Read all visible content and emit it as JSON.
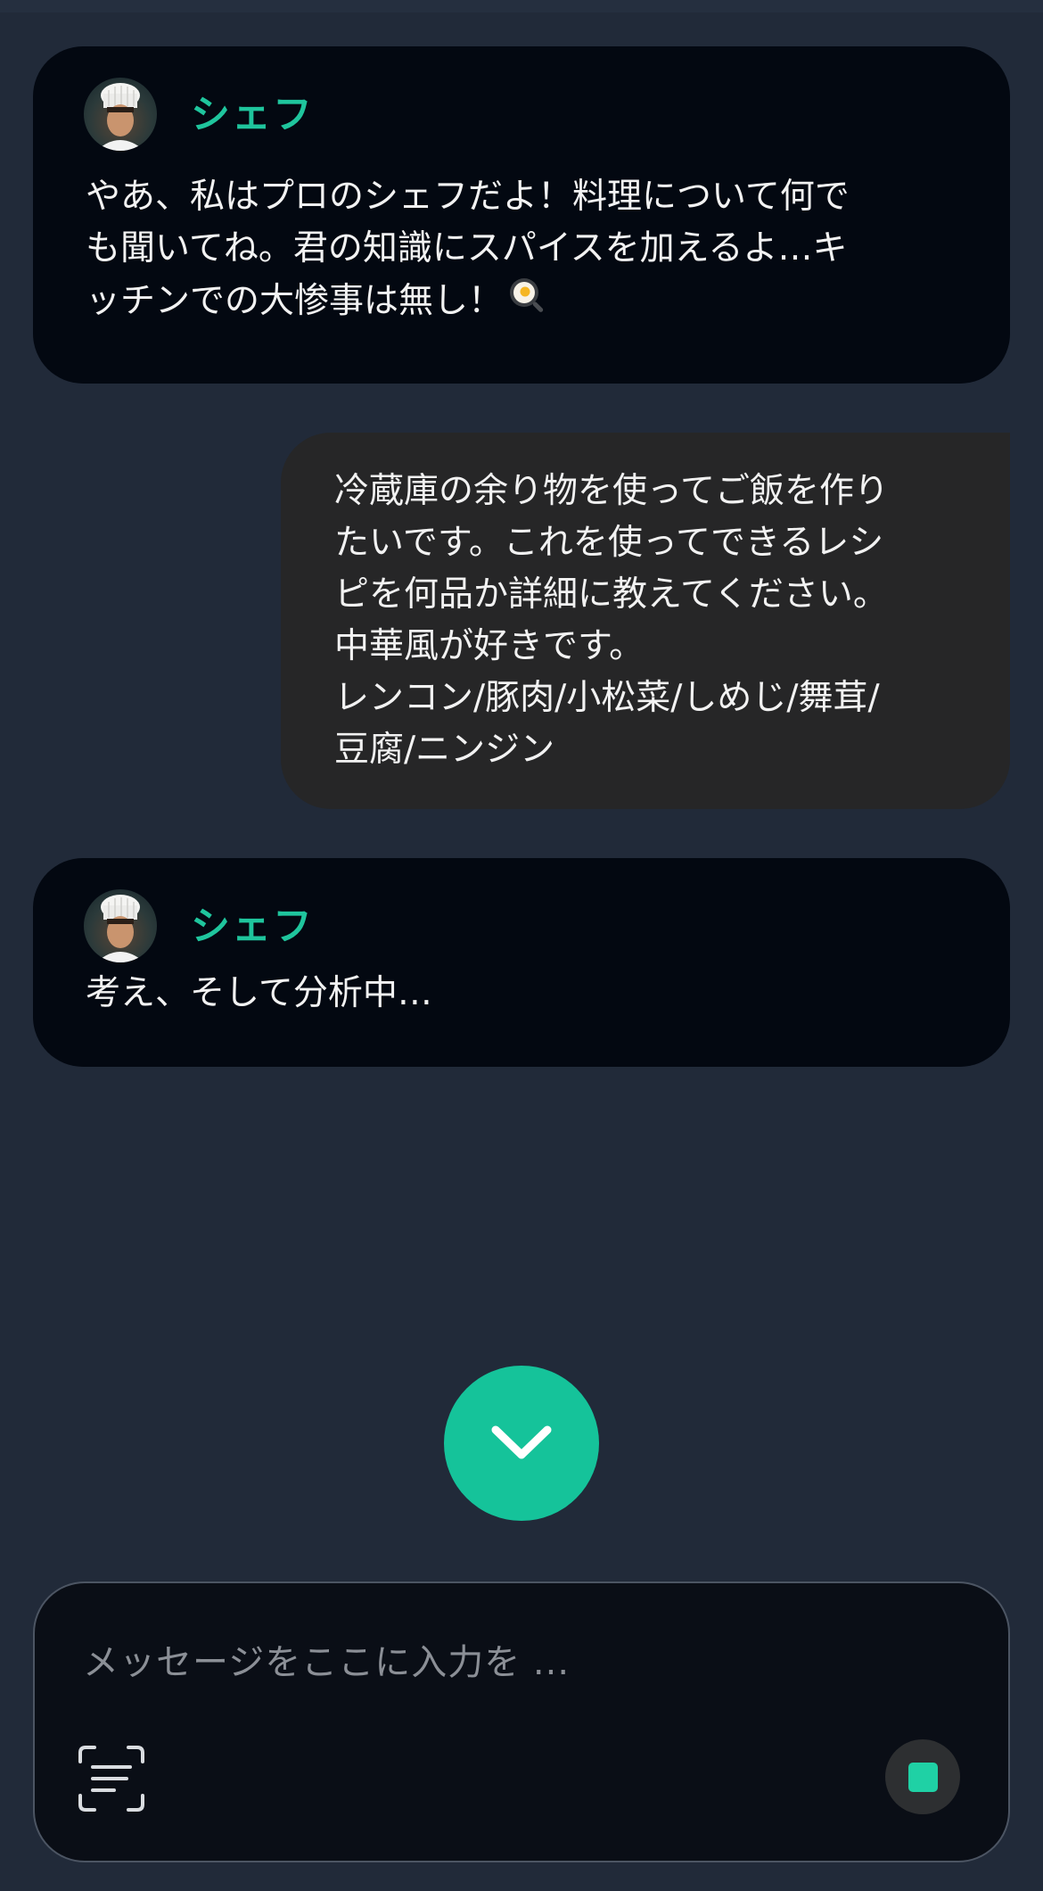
{
  "chat": {
    "bot_name": "シェフ",
    "messages": [
      {
        "role": "bot",
        "name": "シェフ",
        "text": "やあ、私はプロのシェフだよ！料理について何で\nも聞いてね。君の知識にスパイスを加えるよ…キ\nッチンでの大惨事は無し！",
        "emoji": "frying-pan-egg-icon"
      },
      {
        "role": "user",
        "text": "冷蔵庫の余り物を使ってご飯を作り\nたいです。これを使ってできるレシ\nピを何品か詳細に教えてください。\n中華風が好きです。\nレンコン/豚肉/小松菜/しめじ/舞茸/\n豆腐/ニンジン"
      },
      {
        "role": "bot",
        "name": "シェフ",
        "text": "考え、そして分析中…",
        "status": "thinking"
      }
    ]
  },
  "scroll_down_button": {
    "icon": "chevron-down-icon"
  },
  "composer": {
    "placeholder": "メッセージをここに入力を ...",
    "value": "",
    "scan_icon": "scan-text-icon",
    "stop_icon": "stop-icon"
  },
  "colors": {
    "background": "#212a39",
    "bot_bubble": "#030811",
    "user_bubble": "#262627",
    "accent": "#15c39a",
    "name_color": "#1fc59d"
  }
}
